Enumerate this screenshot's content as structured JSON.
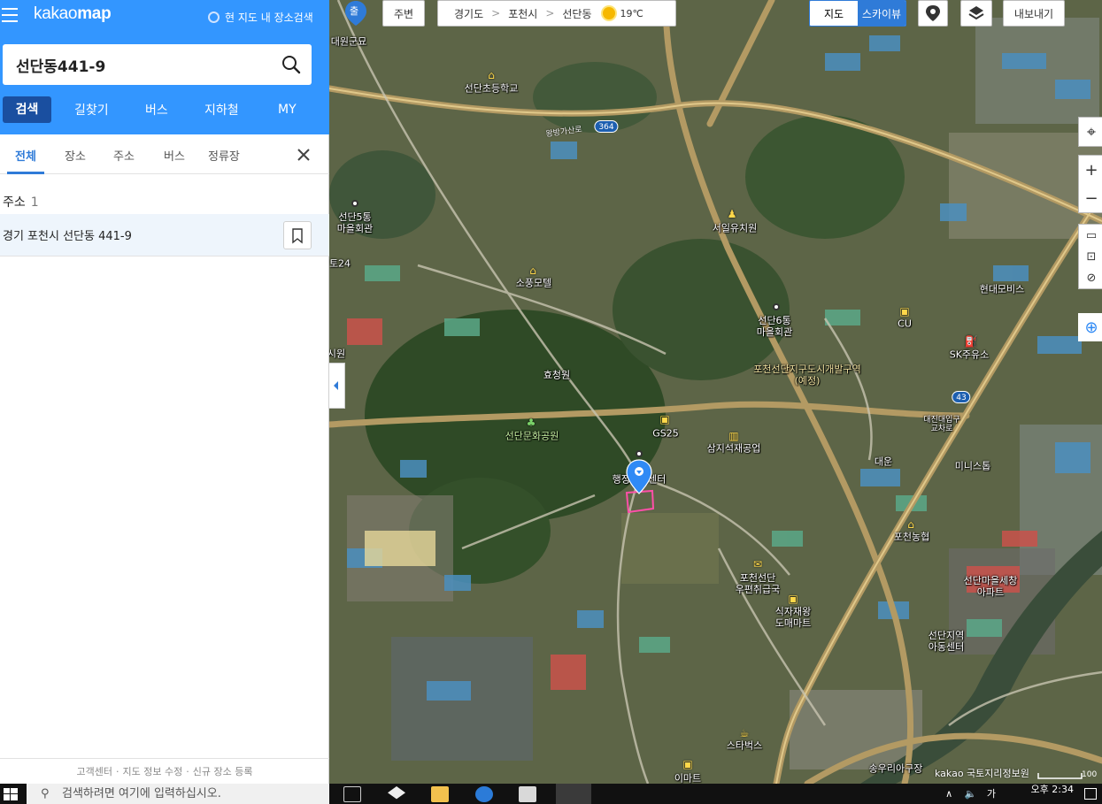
{
  "sidebar": {
    "logo_light": "kakao",
    "logo_bold": "map",
    "area_search_label": "현 지도 내 장소검색",
    "search_value": "선단동441-9",
    "main_nav": [
      "검색",
      "길찾기",
      "버스",
      "지하철",
      "MY"
    ],
    "sub_tabs": [
      "전체",
      "장소",
      "주소",
      "버스",
      "정류장"
    ],
    "result_header": "주소",
    "result_count": "1",
    "result_address": "경기 포천시 선단동 441-9",
    "footer": [
      "고객센터",
      "지도 정보 수정",
      "신규 장소 등록"
    ]
  },
  "map_controls": {
    "start_marker": "출",
    "nearby_label": "주변",
    "breadcrumbs": [
      "경기도",
      "포천시",
      "선단동"
    ],
    "temperature": "19℃",
    "view_map": "지도",
    "view_sky": "스카이뷰",
    "export_label": "내보내기",
    "kakao_credit": "kakao 국토지리정보원",
    "scale_text": "100"
  },
  "map_labels": {
    "daewon": "대원군묘",
    "school": "선단초등학교",
    "road364": "364",
    "roadname": "왕방가산로",
    "maeul5": "선단5통\n마을회관",
    "seoil": "서일유치원",
    "sopung": "소풍모텔",
    "te24": "토24",
    "hyundai": "현대모비스",
    "maeul6": "선단6통\n마을회관",
    "cu": "CU",
    "sk": "SK주유소",
    "plan": "포천선단지구도시개발구역\n(예정)",
    "hyocheong": "효청원",
    "siwon": "시원",
    "road43": "43",
    "gyocharo": "대진대입구\n교차로",
    "park": "선단문화공원",
    "gs25": "GS25",
    "samji": "삼지석재공업",
    "haengjeong": "행정복지센터",
    "daeun": "대운",
    "minis": "미니스톱",
    "nonghyup": "포천농협",
    "post": "포천선단\n우편취급국",
    "apt": "선단마을세창\n아파트",
    "sikjajae": "식자재왕\n도매마트",
    "child": "선단지역\n아동센터",
    "starbucks": "스타벅스",
    "emart": "이마트",
    "songwoo": "송우리아구장"
  },
  "taskbar": {
    "search_placeholder": "검색하려면 여기에 입력하십시오.",
    "ime": "가",
    "time_top": "오후 2:34"
  }
}
